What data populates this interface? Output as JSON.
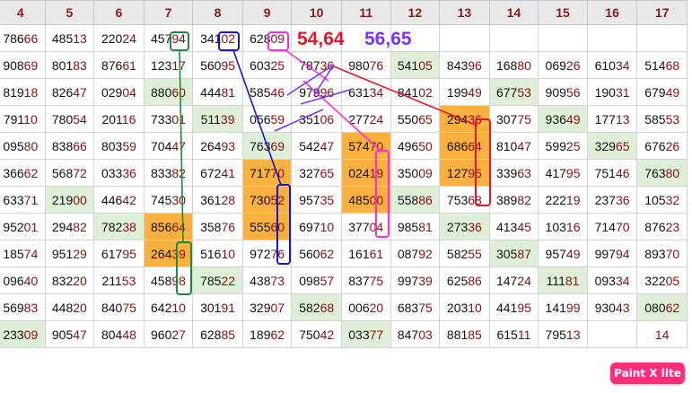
{
  "column_headers": [
    "4",
    "5",
    "6",
    "7",
    "8",
    "9",
    "10",
    "11",
    "12",
    "13",
    "14",
    "15",
    "16",
    "17"
  ],
  "rows": [
    [
      "78666",
      "48513",
      "22024",
      "45794",
      "34102",
      "62809",
      "",
      "",
      "",
      "",
      "",
      "",
      "",
      ""
    ],
    [
      "90869",
      "80183",
      "87661",
      "12317",
      "56095",
      "60325",
      "78736",
      "98076",
      "54105",
      "84396",
      "16880",
      "06926",
      "61034",
      "51468"
    ],
    [
      "81918",
      "82647",
      "02904",
      "88060",
      "44481",
      "58546",
      "97996",
      "63134",
      "84102",
      "19949",
      "67753",
      "90956",
      "19031",
      "67949"
    ],
    [
      "79110",
      "78054",
      "20116",
      "73301",
      "51139",
      "05659",
      "35106",
      "27724",
      "55065",
      "29436",
      "30775",
      "93649",
      "17713",
      "58553"
    ],
    [
      "09580",
      "83866",
      "80359",
      "70447",
      "26493",
      "76369",
      "54247",
      "57470",
      "49650",
      "68664",
      "81047",
      "59925",
      "32965",
      "67626"
    ],
    [
      "36662",
      "56872",
      "03336",
      "83382",
      "67241",
      "71770",
      "32765",
      "02419",
      "35009",
      "12795",
      "33963",
      "41795",
      "75146",
      "76380"
    ],
    [
      "63371",
      "21900",
      "44642",
      "74530",
      "36128",
      "73052",
      "95735",
      "48500",
      "55886",
      "75368",
      "38982",
      "22219",
      "23736",
      "10532"
    ],
    [
      "95201",
      "29482",
      "78238",
      "85664",
      "35876",
      "55560",
      "69710",
      "37704",
      "98581",
      "27336",
      "41345",
      "10316",
      "71470",
      "87623"
    ],
    [
      "18574",
      "95129",
      "61795",
      "26439",
      "51610",
      "97276",
      "56062",
      "16161",
      "08792",
      "58255",
      "30587",
      "95749",
      "99794",
      "89370"
    ],
    [
      "09640",
      "83220",
      "21153",
      "45898",
      "78522",
      "43873",
      "09857",
      "83775",
      "99739",
      "62586",
      "14724",
      "11181",
      "09334",
      "32205"
    ],
    [
      "56983",
      "44820",
      "84075",
      "64210",
      "30191",
      "32907",
      "58268",
      "00620",
      "68375",
      "20310",
      "44195",
      "14199",
      "93043",
      "08062"
    ],
    [
      "23309",
      "90547",
      "80448",
      "96027",
      "62885",
      "18962",
      "75042",
      "03377",
      "84703",
      "88185",
      "61511",
      "79513",
      "",
      "14"
    ]
  ],
  "highlights": {
    "green": [
      "1,8",
      "2,3",
      "2,10",
      "3,4",
      "3,11",
      "4,5",
      "4,12",
      "5,13",
      "6,1",
      "6,8",
      "7,2",
      "7,9",
      "8,10",
      "9,4",
      "9,11",
      "10,6",
      "10,13",
      "11,0",
      "11,7"
    ],
    "orange": [
      "3,9",
      "4,7",
      "4,9",
      "5,5",
      "5,7",
      "5,9",
      "6,5",
      "6,7",
      "7,3",
      "7,5",
      "8,3"
    ]
  },
  "labels": {
    "red": "54,64",
    "purple": "56,65"
  },
  "badge": "Paint X lite",
  "colors": {
    "red": "#e8152a",
    "purple": "#7a33ff",
    "blue": "#1414d8",
    "magenta": "#ff2bd6",
    "green": "#1f8a3a",
    "orange": "#fbb040"
  }
}
